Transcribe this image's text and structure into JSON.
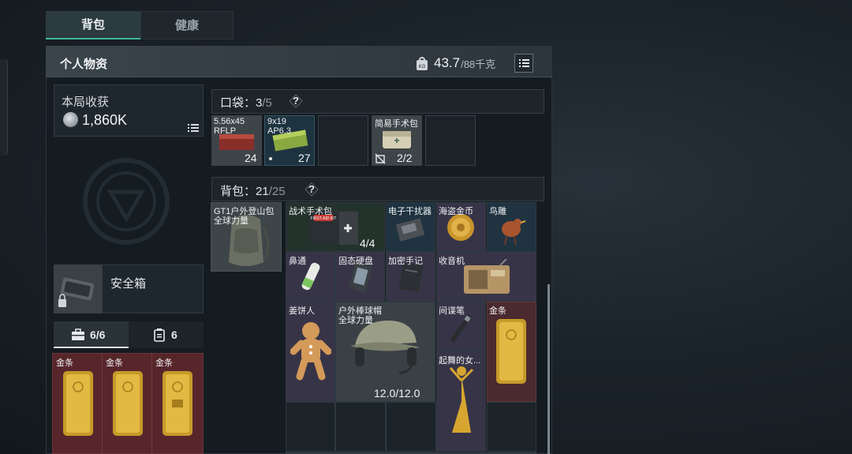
{
  "tabs": {
    "bag": "背包",
    "health": "健康"
  },
  "panel": {
    "title": "个人物资",
    "weight_current": "43.7",
    "weight_max": "/88千克"
  },
  "harvest": {
    "title": "本局收获",
    "value": "1,860K"
  },
  "safebox": {
    "label": "安全箱"
  },
  "subtabs": {
    "tools_count": "6/6",
    "cards_count": "6"
  },
  "left_gold": {
    "label1": "金条",
    "label2": "金条",
    "label3": "金条"
  },
  "pocket": {
    "label": "口袋：",
    "current": "3",
    "max": "/5",
    "q": "?",
    "item1": {
      "name_line1": "5.56x45",
      "name_line2": "RFLP",
      "count": "24"
    },
    "item2": {
      "name_line1": "9x19",
      "name_line2": "AP6.3",
      "count": "27"
    },
    "item3": {
      "name": "简易手术包",
      "count": "2/2"
    }
  },
  "backpack": {
    "label": "背包：",
    "current": "21",
    "max": "/25",
    "q": "?",
    "gt1": {
      "line1": "GT1户外登山包",
      "line2": "全球力量"
    },
    "items": {
      "surgery": {
        "name": "战术手术包",
        "count": "4/4",
        "kit_text": "FIRST AID KIT"
      },
      "jammer": "电子干扰器",
      "coin": "海盗金币",
      "bird": "鸟雕",
      "nasal": "鼻通",
      "ssd": "固态硬盘",
      "notes": "加密手记",
      "radio": "收音机",
      "gingerbread": "姜饼人",
      "cap": {
        "line1": "户外棒球帽",
        "line2": "全球力量",
        "durability": "12.0/12.0"
      },
      "pen": "间谍笔",
      "gold": "金条",
      "dancer": "起舞的女..."
    }
  }
}
